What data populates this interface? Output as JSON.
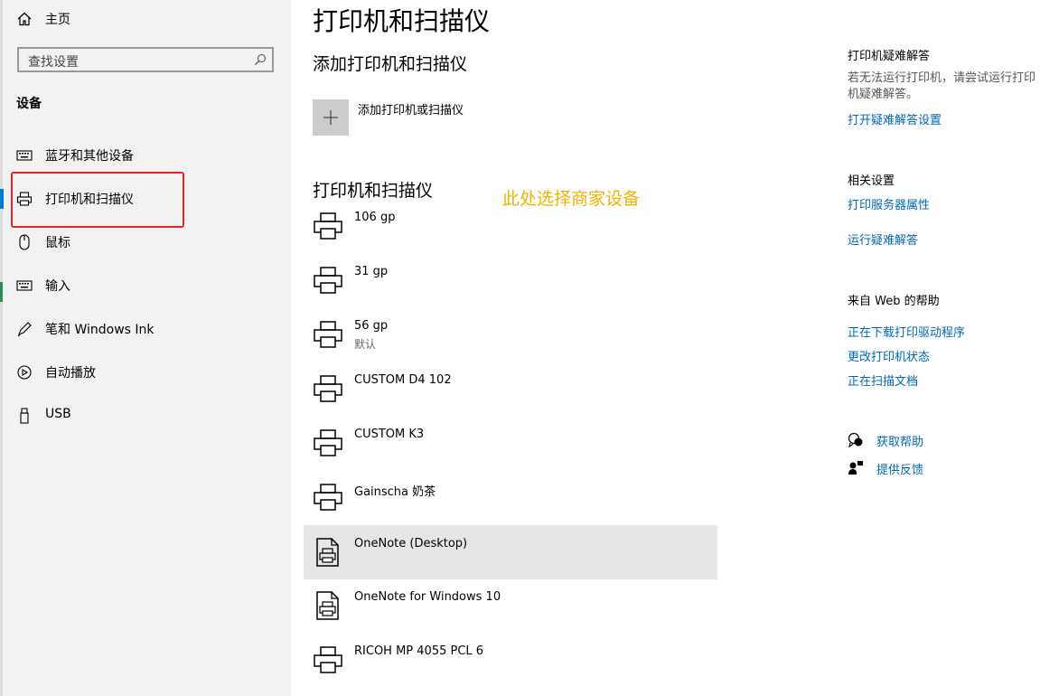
{
  "sidebar": {
    "home_label": "主页",
    "search_placeholder": "查找设置",
    "section_label": "设备",
    "items": [
      {
        "label": "蓝牙和其他设备",
        "icon": "keyboard-bluetooth-icon"
      },
      {
        "label": "打印机和扫描仪",
        "icon": "printer-icon",
        "selected": true
      },
      {
        "label": "鼠标",
        "icon": "mouse-icon"
      },
      {
        "label": "输入",
        "icon": "keyboard-icon"
      },
      {
        "label": "笔和 Windows Ink",
        "icon": "pen-icon"
      },
      {
        "label": "自动播放",
        "icon": "autoplay-icon"
      },
      {
        "label": "USB",
        "icon": "usb-icon"
      }
    ]
  },
  "main": {
    "title": "打印机和扫描仪",
    "add_heading": "添加打印机和扫描仪",
    "add_label": "添加打印机或扫描仪",
    "list_heading": "打印机和扫描仪",
    "annotation": "此处选择商家设备",
    "printers": [
      {
        "name": "106 gp",
        "sub": "",
        "icon": "printer-icon"
      },
      {
        "name": "31 gp",
        "sub": "",
        "icon": "printer-icon"
      },
      {
        "name": "56 gp",
        "sub": "默认",
        "icon": "printer-icon"
      },
      {
        "name": "CUSTOM D4 102",
        "sub": "",
        "icon": "printer-icon"
      },
      {
        "name": "CUSTOM K3",
        "sub": "",
        "icon": "printer-icon"
      },
      {
        "name": "Gainscha 奶茶",
        "sub": "",
        "icon": "printer-icon"
      },
      {
        "name": "OneNote (Desktop)",
        "sub": "",
        "icon": "document-printer-icon",
        "selected": true
      },
      {
        "name": "OneNote for Windows 10",
        "sub": "",
        "icon": "document-printer-icon"
      },
      {
        "name": "RICOH MP 4055 PCL 6",
        "sub": "",
        "icon": "printer-icon"
      }
    ]
  },
  "right": {
    "troubleshoot_heading": "打印机疑难解答",
    "troubleshoot_text": "若无法运行打印机，请尝试运行打印机疑难解答。",
    "troubleshoot_link": "打开疑难解答设置",
    "related_heading": "相关设置",
    "related_links": [
      "打印服务器属性",
      "运行疑难解答"
    ],
    "web_help_heading": "来自 Web 的帮助",
    "web_links": [
      "正在下载打印驱动程序",
      "更改打印机状态",
      "正在扫描文档"
    ],
    "get_help": "获取帮助",
    "feedback": "提供反馈"
  },
  "colors": {
    "accent": "#0078d7",
    "link": "#0067b8",
    "highlight_box": "#e8212b",
    "annotation": "#f0b400"
  }
}
